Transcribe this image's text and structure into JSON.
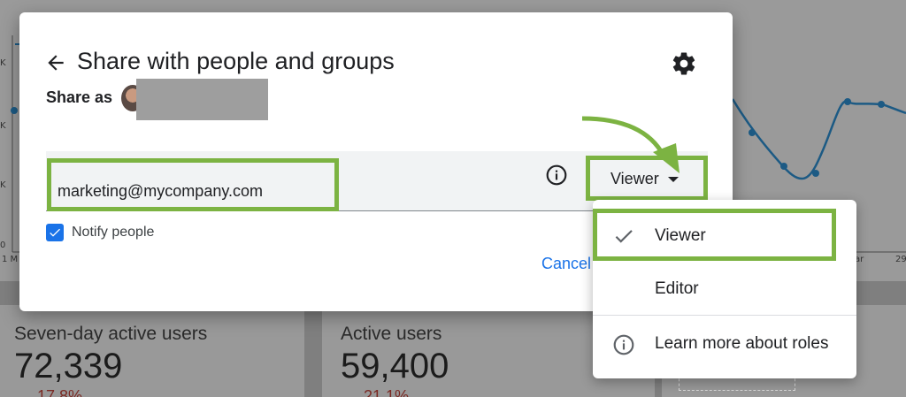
{
  "dialog": {
    "title": "Share with people and groups",
    "share_as_label": "Share as",
    "email_value": "marketing@mycompany.com",
    "role_selected": "Viewer",
    "notify_label": "Notify people",
    "notify_checked": true,
    "cancel_label": "Cancel"
  },
  "menu": {
    "items": [
      {
        "label": "Viewer",
        "icon": "check-icon",
        "selected": true
      },
      {
        "label": "Editor",
        "icon": "",
        "selected": false
      },
      {
        "label": "Learn more about roles",
        "icon": "info-icon",
        "selected": false
      }
    ]
  },
  "background": {
    "axis_labels": [
      "K",
      "K",
      "K",
      "0"
    ],
    "x_labels": [
      "1 M",
      "ar",
      "29"
    ],
    "cards": [
      {
        "label": "Seven-day active users",
        "value": "72,339",
        "delta": "17.8%"
      },
      {
        "label": "Active users",
        "value": "59,400",
        "delta": "21.1%"
      }
    ]
  },
  "colors": {
    "highlight": "#7cb342",
    "accent": "#1a73e8",
    "overlay": "#8a8a8a"
  }
}
